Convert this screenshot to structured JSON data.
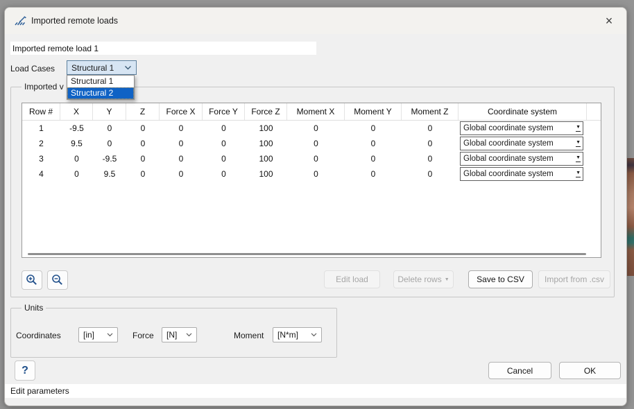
{
  "window": {
    "title": "Imported remote loads",
    "close_glyph": "×"
  },
  "fields": {
    "name_value": "Imported remote load 1"
  },
  "load_cases": {
    "label": "Load Cases",
    "selected": "Structural 1",
    "options": [
      "Structural 1",
      "Structural 2"
    ],
    "highlighted_option": "Structural 2"
  },
  "imported_group": {
    "label": "Imported v"
  },
  "table": {
    "columns": [
      "Row #",
      "X",
      "Y",
      "Z",
      "Force X",
      "Force Y",
      "Force Z",
      "Moment X",
      "Moment Y",
      "Moment Z",
      "Coordinate system"
    ],
    "rows": [
      {
        "cells": [
          "1",
          "-9.5",
          "0",
          "0",
          "0",
          "0",
          "100",
          "0",
          "0",
          "0"
        ],
        "coordinate_system": "Global coordinate system"
      },
      {
        "cells": [
          "2",
          "9.5",
          "0",
          "0",
          "0",
          "0",
          "100",
          "0",
          "0",
          "0"
        ],
        "coordinate_system": "Global coordinate system"
      },
      {
        "cells": [
          "3",
          "0",
          "-9.5",
          "0",
          "0",
          "0",
          "100",
          "0",
          "0",
          "0"
        ],
        "coordinate_system": "Global coordinate system"
      },
      {
        "cells": [
          "4",
          "0",
          "9.5",
          "0",
          "0",
          "0",
          "100",
          "0",
          "0",
          "0"
        ],
        "coordinate_system": "Global coordinate system"
      }
    ],
    "dropdown_arrow_glyph": "▼"
  },
  "actions": {
    "edit_load": "Edit load",
    "delete_rows": "Delete rows",
    "delete_rows_arrow": "▼",
    "save_csv": "Save to CSV",
    "import_csv": "Import from .csv"
  },
  "units": {
    "label": "Units",
    "coordinates_label": "Coordinates",
    "coordinates_value": "[in]",
    "force_label": "Force",
    "force_value": "[N]",
    "moment_label": "Moment",
    "moment_value": "[N*m]"
  },
  "footer": {
    "help": "?",
    "cancel": "Cancel",
    "ok": "OK",
    "status": "Edit parameters"
  },
  "colors": {
    "selection_blue": "#0f62c5",
    "combo_focus_bg": "#d7e5f3",
    "icon_blue": "#2e5f98",
    "dialog_bg": "#f0f0f0"
  }
}
